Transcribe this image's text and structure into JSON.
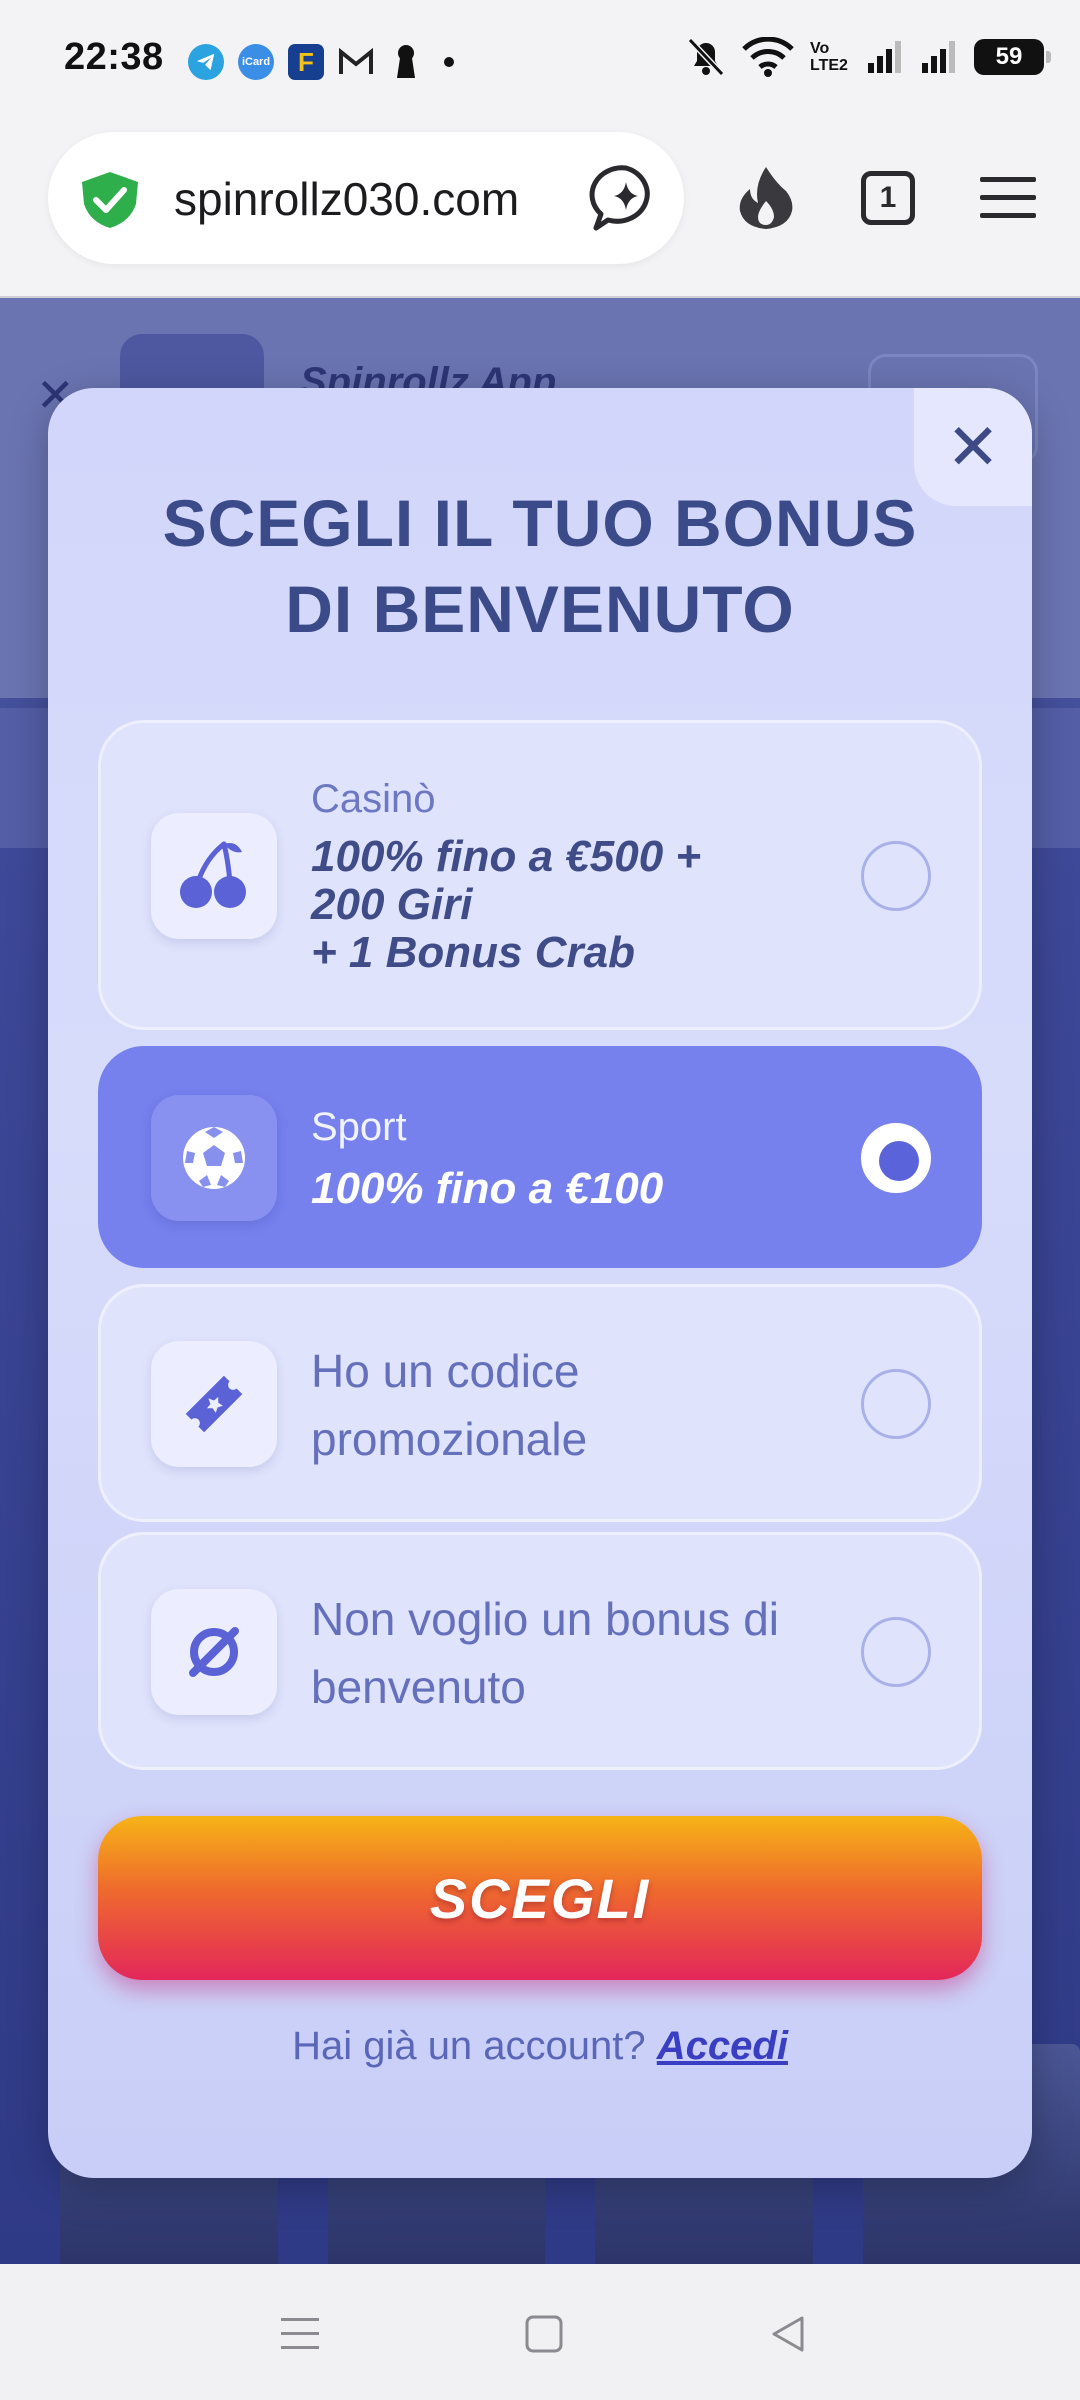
{
  "status_bar": {
    "time": "22:38",
    "battery": "59",
    "network_label": "Vo LTE2"
  },
  "browser": {
    "url": "spinrollz030.com",
    "tab_count": "1"
  },
  "background_page": {
    "app_title": "Spinrollz App"
  },
  "modal": {
    "title_line1": "SCEGLI IL TUO BONUS",
    "title_line2": "DI BENVENUTO",
    "close_symbol": "✕",
    "options": [
      {
        "label": "Casinò",
        "desc_line1": "100% fino a €500 +",
        "desc_line2": "200 Giri",
        "desc_line3": "+ 1 Bonus Crab",
        "icon": "cherries-icon",
        "selected": false
      },
      {
        "label": "Sport",
        "desc_line1": "100% fino a €100",
        "icon": "soccer-ball-icon",
        "selected": true
      },
      {
        "text_line1": "Ho un codice",
        "text_line2": "promozionale",
        "icon": "ticket-icon",
        "selected": false
      },
      {
        "text_line1": "Non voglio un bonus di",
        "text_line2": "benvenuto",
        "icon": "no-symbol-icon",
        "selected": false
      }
    ],
    "cta_label": "SCEGLI",
    "login_prompt": "Hai già un account?",
    "login_link": "Accedi"
  },
  "colors": {
    "accent": "#7781ee",
    "title": "#3b4a88",
    "cta_top": "#f6b416",
    "cta_bottom": "#e3275a"
  }
}
